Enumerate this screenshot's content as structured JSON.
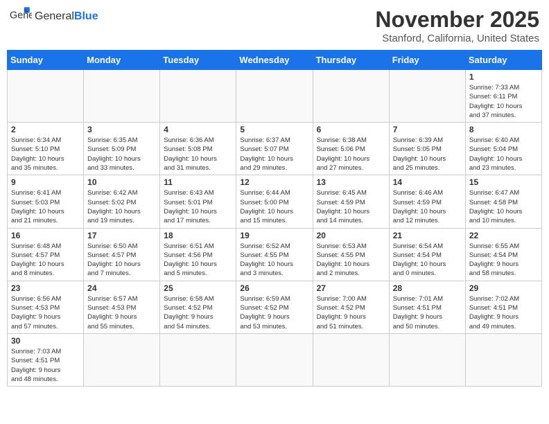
{
  "header": {
    "logo_general": "General",
    "logo_blue": "Blue",
    "month": "November 2025",
    "location": "Stanford, California, United States"
  },
  "weekdays": [
    "Sunday",
    "Monday",
    "Tuesday",
    "Wednesday",
    "Thursday",
    "Friday",
    "Saturday"
  ],
  "weeks": [
    [
      {
        "day": "",
        "info": ""
      },
      {
        "day": "",
        "info": ""
      },
      {
        "day": "",
        "info": ""
      },
      {
        "day": "",
        "info": ""
      },
      {
        "day": "",
        "info": ""
      },
      {
        "day": "",
        "info": ""
      },
      {
        "day": "1",
        "info": "Sunrise: 7:33 AM\nSunset: 6:11 PM\nDaylight: 10 hours\nand 37 minutes."
      }
    ],
    [
      {
        "day": "2",
        "info": "Sunrise: 6:34 AM\nSunset: 5:10 PM\nDaylight: 10 hours\nand 35 minutes."
      },
      {
        "day": "3",
        "info": "Sunrise: 6:35 AM\nSunset: 5:09 PM\nDaylight: 10 hours\nand 33 minutes."
      },
      {
        "day": "4",
        "info": "Sunrise: 6:36 AM\nSunset: 5:08 PM\nDaylight: 10 hours\nand 31 minutes."
      },
      {
        "day": "5",
        "info": "Sunrise: 6:37 AM\nSunset: 5:07 PM\nDaylight: 10 hours\nand 29 minutes."
      },
      {
        "day": "6",
        "info": "Sunrise: 6:38 AM\nSunset: 5:06 PM\nDaylight: 10 hours\nand 27 minutes."
      },
      {
        "day": "7",
        "info": "Sunrise: 6:39 AM\nSunset: 5:05 PM\nDaylight: 10 hours\nand 25 minutes."
      },
      {
        "day": "8",
        "info": "Sunrise: 6:40 AM\nSunset: 5:04 PM\nDaylight: 10 hours\nand 23 minutes."
      }
    ],
    [
      {
        "day": "9",
        "info": "Sunrise: 6:41 AM\nSunset: 5:03 PM\nDaylight: 10 hours\nand 21 minutes."
      },
      {
        "day": "10",
        "info": "Sunrise: 6:42 AM\nSunset: 5:02 PM\nDaylight: 10 hours\nand 19 minutes."
      },
      {
        "day": "11",
        "info": "Sunrise: 6:43 AM\nSunset: 5:01 PM\nDaylight: 10 hours\nand 17 minutes."
      },
      {
        "day": "12",
        "info": "Sunrise: 6:44 AM\nSunset: 5:00 PM\nDaylight: 10 hours\nand 15 minutes."
      },
      {
        "day": "13",
        "info": "Sunrise: 6:45 AM\nSunset: 4:59 PM\nDaylight: 10 hours\nand 14 minutes."
      },
      {
        "day": "14",
        "info": "Sunrise: 6:46 AM\nSunset: 4:59 PM\nDaylight: 10 hours\nand 12 minutes."
      },
      {
        "day": "15",
        "info": "Sunrise: 6:47 AM\nSunset: 4:58 PM\nDaylight: 10 hours\nand 10 minutes."
      }
    ],
    [
      {
        "day": "16",
        "info": "Sunrise: 6:48 AM\nSunset: 4:57 PM\nDaylight: 10 hours\nand 8 minutes."
      },
      {
        "day": "17",
        "info": "Sunrise: 6:50 AM\nSunset: 4:57 PM\nDaylight: 10 hours\nand 7 minutes."
      },
      {
        "day": "18",
        "info": "Sunrise: 6:51 AM\nSunset: 4:56 PM\nDaylight: 10 hours\nand 5 minutes."
      },
      {
        "day": "19",
        "info": "Sunrise: 6:52 AM\nSunset: 4:55 PM\nDaylight: 10 hours\nand 3 minutes."
      },
      {
        "day": "20",
        "info": "Sunrise: 6:53 AM\nSunset: 4:55 PM\nDaylight: 10 hours\nand 2 minutes."
      },
      {
        "day": "21",
        "info": "Sunrise: 6:54 AM\nSunset: 4:54 PM\nDaylight: 10 hours\nand 0 minutes."
      },
      {
        "day": "22",
        "info": "Sunrise: 6:55 AM\nSunset: 4:54 PM\nDaylight: 9 hours\nand 58 minutes."
      }
    ],
    [
      {
        "day": "23",
        "info": "Sunrise: 6:56 AM\nSunset: 4:53 PM\nDaylight: 9 hours\nand 57 minutes."
      },
      {
        "day": "24",
        "info": "Sunrise: 6:57 AM\nSunset: 4:53 PM\nDaylight: 9 hours\nand 55 minutes."
      },
      {
        "day": "25",
        "info": "Sunrise: 6:58 AM\nSunset: 4:52 PM\nDaylight: 9 hours\nand 54 minutes."
      },
      {
        "day": "26",
        "info": "Sunrise: 6:59 AM\nSunset: 4:52 PM\nDaylight: 9 hours\nand 53 minutes."
      },
      {
        "day": "27",
        "info": "Sunrise: 7:00 AM\nSunset: 4:52 PM\nDaylight: 9 hours\nand 51 minutes."
      },
      {
        "day": "28",
        "info": "Sunrise: 7:01 AM\nSunset: 4:51 PM\nDaylight: 9 hours\nand 50 minutes."
      },
      {
        "day": "29",
        "info": "Sunrise: 7:02 AM\nSunset: 4:51 PM\nDaylight: 9 hours\nand 49 minutes."
      }
    ],
    [
      {
        "day": "30",
        "info": "Sunrise: 7:03 AM\nSunset: 4:51 PM\nDaylight: 9 hours\nand 48 minutes."
      },
      {
        "day": "",
        "info": ""
      },
      {
        "day": "",
        "info": ""
      },
      {
        "day": "",
        "info": ""
      },
      {
        "day": "",
        "info": ""
      },
      {
        "day": "",
        "info": ""
      },
      {
        "day": "",
        "info": ""
      }
    ]
  ]
}
